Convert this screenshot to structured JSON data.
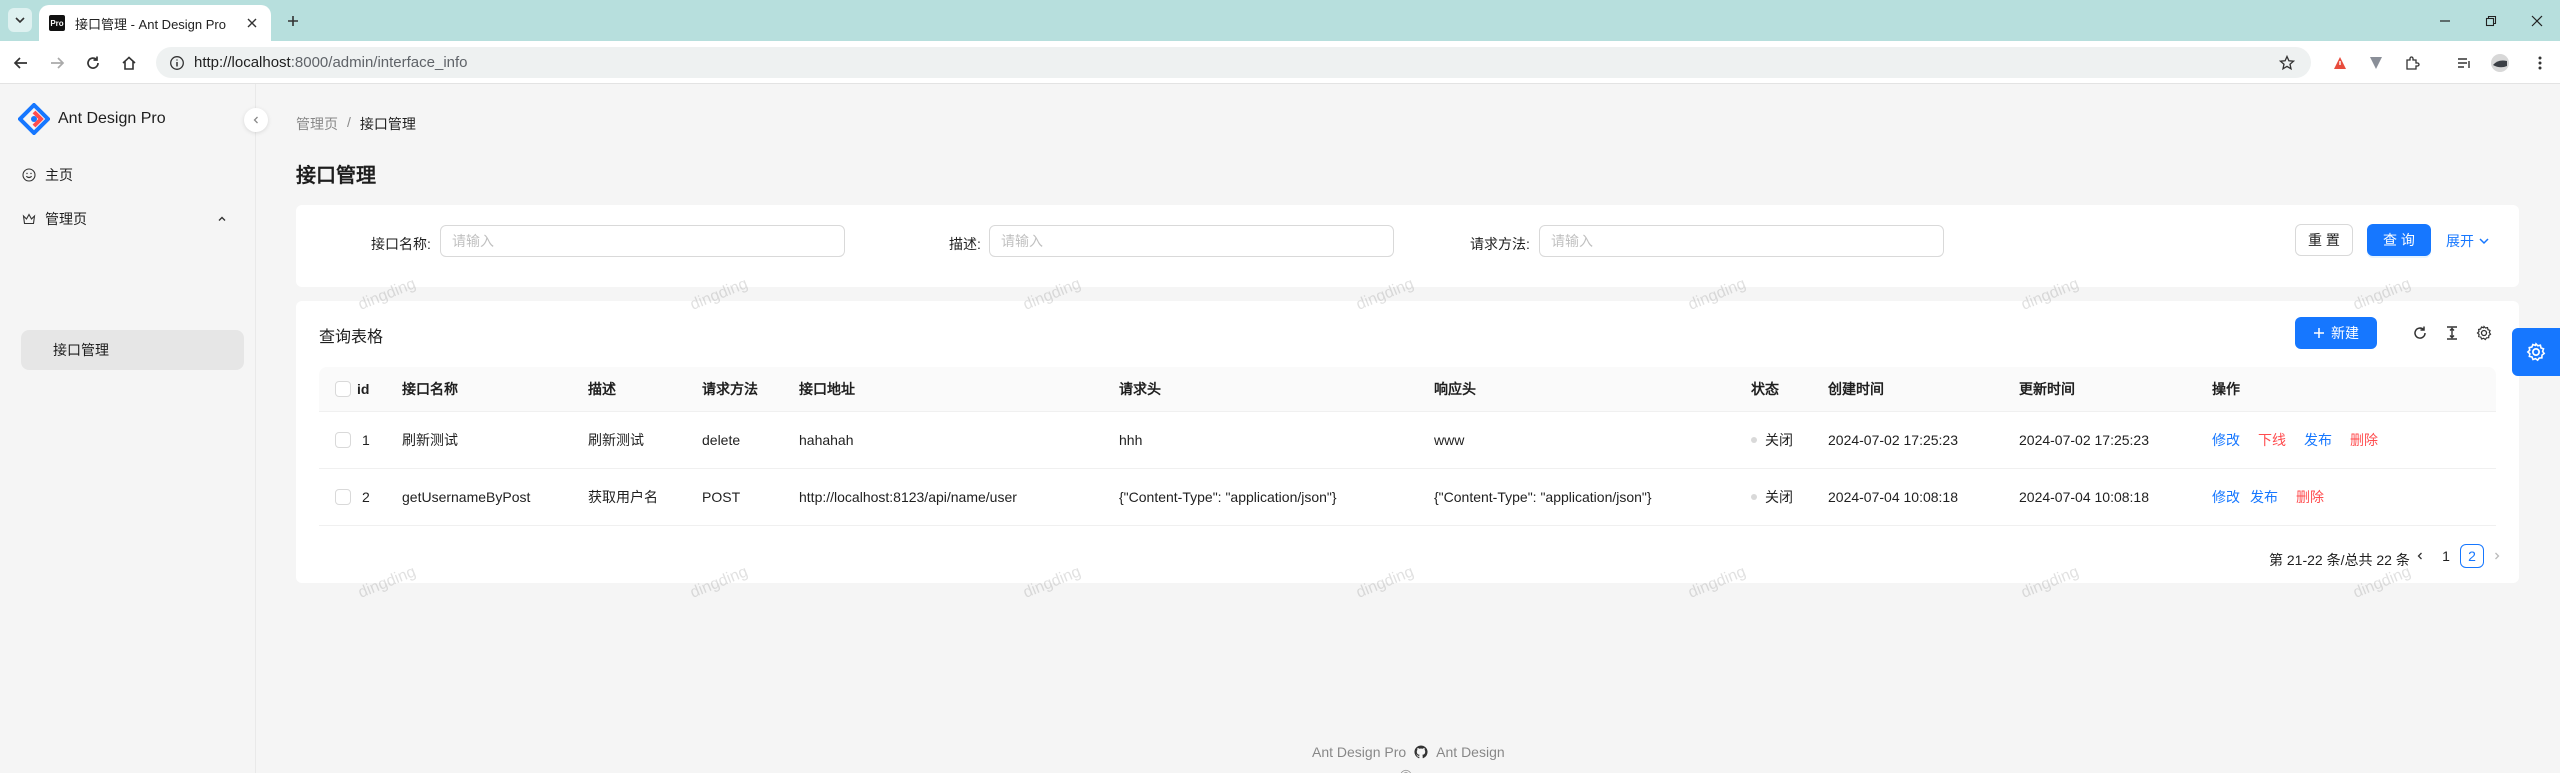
{
  "browser": {
    "tab_title": "Ant Design Pro",
    "tab_title_full": "接口管理 - Ant Design Pro",
    "favicon_text": "Pro",
    "url_host": "http://localhost",
    "url_path": ":8000/admin/interface_info"
  },
  "app": {
    "logo_text": "Ant Design Pro",
    "menu": {
      "home": "主页",
      "admin": "管理页",
      "interface": "接口管理"
    }
  },
  "breadcrumb": {
    "root": "管理页",
    "sep": "/",
    "current": "接口管理"
  },
  "page_title": "接口管理",
  "search": {
    "name_label": "接口名称:",
    "desc_label": "描述:",
    "method_label": "请求方法:",
    "placeholder": "请输入",
    "reset_label": "重 置",
    "query_label": "查 询",
    "expand_label": "展开"
  },
  "table": {
    "title": "查询表格",
    "new_label": "新建",
    "headers": {
      "id": "id",
      "name": "接口名称",
      "desc": "描述",
      "method": "请求方法",
      "url": "接口地址",
      "req": "请求头",
      "resp": "响应头",
      "status": "状态",
      "created": "创建时间",
      "updated": "更新时间",
      "ops": "操作"
    },
    "rows": [
      {
        "id": "1",
        "name": "刷新测试",
        "desc": "刷新测试",
        "method": "delete",
        "url": "hahahah",
        "req": "hhh",
        "resp": "www",
        "status": "关闭",
        "created": "2024-07-02 17:25:23",
        "updated": "2024-07-02 17:25:23",
        "op1": "修改",
        "op2": "下线",
        "op3": "发布",
        "op4": "删除"
      },
      {
        "id": "2",
        "name": "getUsernameByPost",
        "desc": "获取用户名",
        "method": "POST",
        "url": "http://localhost:8123/api/name/user",
        "req": "{\"Content-Type\": \"application/json\"}",
        "resp": "{\"Content-Type\": \"application/json\"}",
        "status": "关闭",
        "created": "2024-07-04 10:08:18",
        "updated": "2024-07-04 10:08:18",
        "op1": "修改",
        "op2": "发布",
        "op3": "删除"
      }
    ],
    "pagination": {
      "summary": "第 21-22 条/总共 22 条",
      "page1": "1",
      "page2": "2"
    }
  },
  "footer": {
    "link1": "Ant Design Pro",
    "link2": "Ant Design",
    "copyright": "©"
  },
  "watermark_text": "dingding",
  "colors": {
    "primary": "#1677ff",
    "danger": "#ff4d4f",
    "tabbar": "#b7dfdd"
  }
}
